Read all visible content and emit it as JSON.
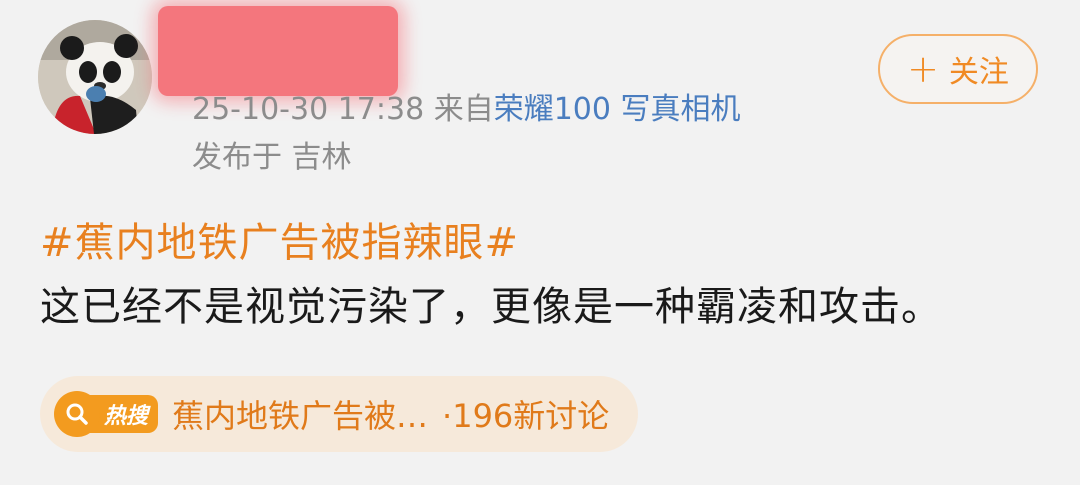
{
  "post": {
    "timestamp": "25-10-30 17:38",
    "source_prefix": "来自",
    "device": "荣耀100 写真相机",
    "location": "发布于 吉林",
    "follow_label": "关注",
    "topic": "#蕉内地铁广告被指辣眼#",
    "text": "这已经不是视觉污染了，更像是一种霸凌和攻击。"
  },
  "hot_search": {
    "badge": "热搜",
    "title": "蕉内地铁广告被…",
    "count": "·196新讨论"
  },
  "colors": {
    "accent_orange": "#e8801f",
    "device_blue": "#4a7dbf",
    "redaction": "#f56c74"
  },
  "icons": {
    "avatar": "panda-avatar",
    "follow": "plus-icon",
    "hot_search": "search-icon"
  }
}
